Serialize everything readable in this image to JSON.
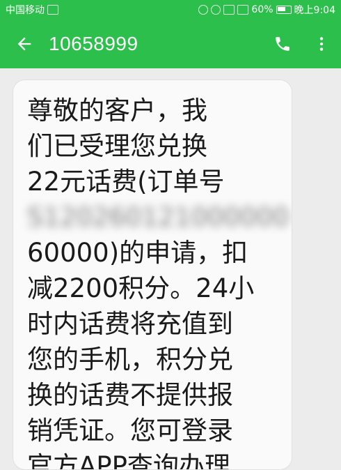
{
  "status_bar": {
    "carrier": "中国移动",
    "battery": "60%",
    "time": "晚上9:04"
  },
  "header": {
    "title": "10658999"
  },
  "message": {
    "lines": [
      "尊敬的客户，我",
      "们已受理您兑换",
      "22元话费(订单号",
      "S120260121000000",
      "60000)的申请，扣",
      "减2200积分。24小",
      "时内话费将充值到",
      "您的手机，积分兑",
      "换的话费不提供报",
      "销凭证。您可登录",
      "官方APP查询办理"
    ]
  },
  "colors": {
    "accent": "#2cbf4b",
    "bubble": "#fafafa",
    "background": "#ececec",
    "text": "#1a1a1a"
  },
  "icons": {
    "back": "arrow-left-icon",
    "call": "phone-icon",
    "more": "more-vert-icon"
  }
}
